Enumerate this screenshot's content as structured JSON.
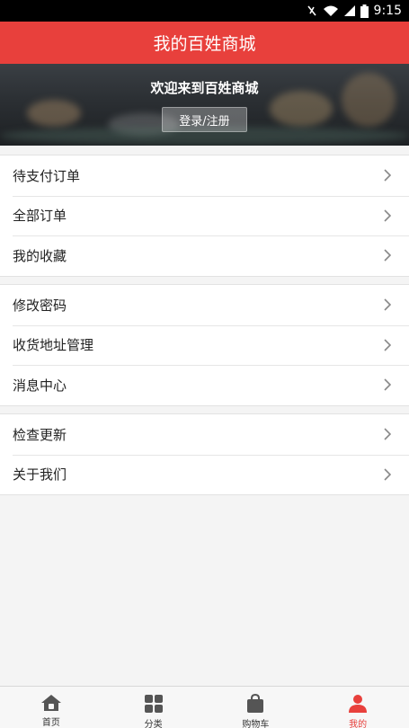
{
  "status_bar": {
    "time": "9:15"
  },
  "header": {
    "title": "我的百姓商城"
  },
  "banner": {
    "welcome": "欢迎来到百姓商城",
    "login_label": "登录/注册"
  },
  "menu_groups": [
    {
      "items": [
        {
          "label": "待支付订单"
        },
        {
          "label": "全部订单"
        },
        {
          "label": "我的收藏"
        }
      ]
    },
    {
      "items": [
        {
          "label": "修改密码"
        },
        {
          "label": "收货地址管理"
        },
        {
          "label": "消息中心"
        }
      ]
    },
    {
      "items": [
        {
          "label": "检查更新"
        },
        {
          "label": "关于我们"
        }
      ]
    }
  ],
  "tabbar": {
    "items": [
      {
        "label": "首页",
        "icon": "home-icon"
      },
      {
        "label": "分类",
        "icon": "category-grid-icon"
      },
      {
        "label": "购物车",
        "icon": "shopping-bag-icon"
      },
      {
        "label": "我的",
        "icon": "user-icon",
        "active": true
      }
    ],
    "active_color": "#e8403c",
    "inactive_color": "#555555"
  },
  "colors": {
    "brand": "#e8403c",
    "background": "#f4f4f4"
  }
}
